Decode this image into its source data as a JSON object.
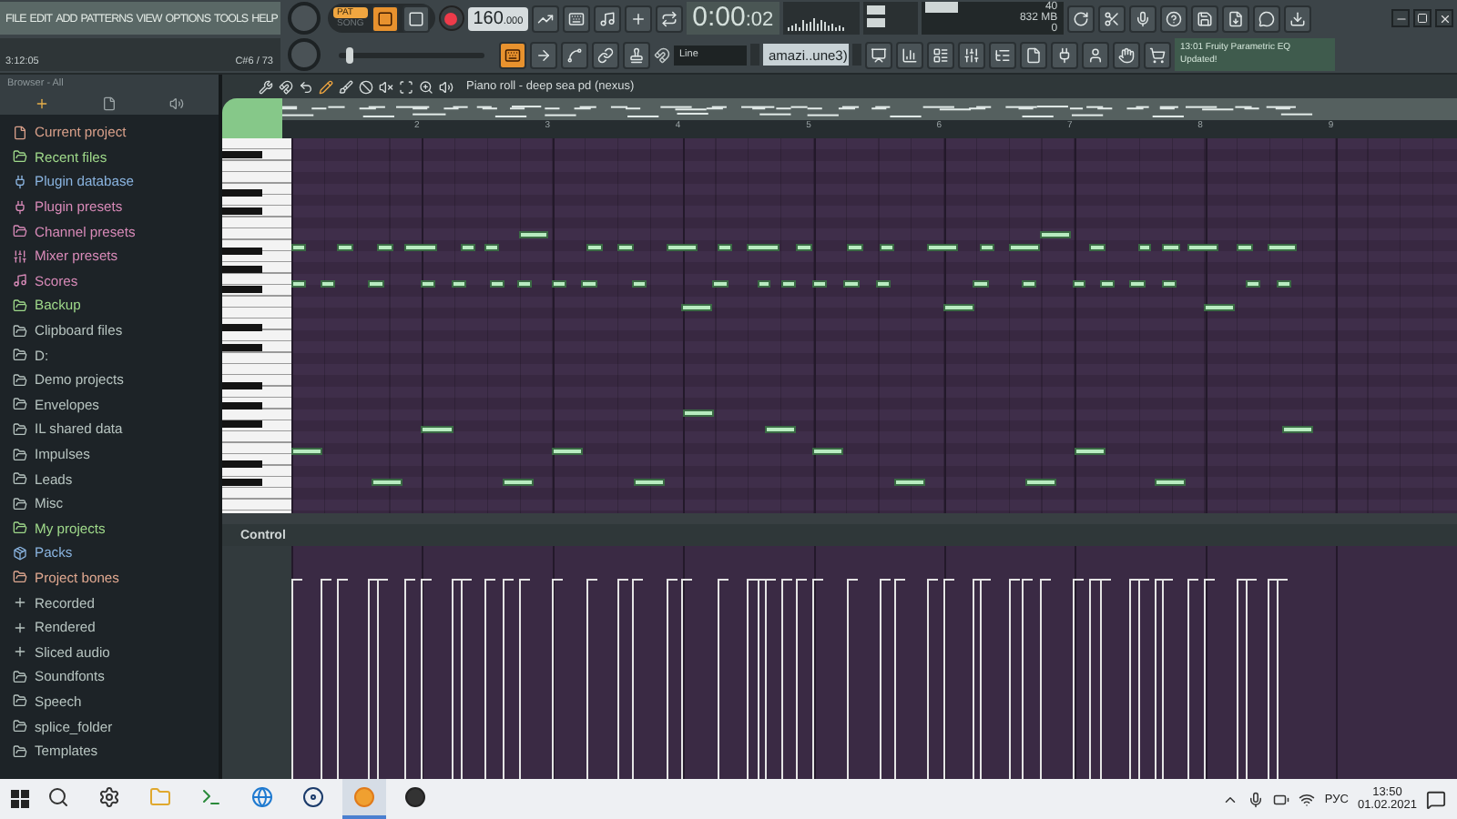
{
  "menu": [
    "FILE",
    "EDIT",
    "ADD",
    "PATTERNS",
    "VIEW",
    "OPTIONS",
    "TOOLS",
    "HELP"
  ],
  "hint_bar": {
    "time": "3:12:05",
    "note": "C#6 / 73"
  },
  "pitch": {
    "level": 0.05
  },
  "transport": {
    "modes": [
      {
        "label": "PAT",
        "selected": true
      },
      {
        "label": "SONG",
        "selected": false
      }
    ],
    "tempo": "160",
    "tempo_fraction": ".000",
    "time": "0:00",
    "seconds": ":02"
  },
  "monitor": {
    "voices": "40",
    "memory": "832 MB",
    "cpu": "0"
  },
  "snap": "Line",
  "pattern": "amazi..une3)",
  "news": {
    "text": "13:01  Fruity Parametric EQ",
    "subtext": "Updated!"
  },
  "browser": {
    "title": "Browser - All",
    "items": [
      {
        "label": "Current project",
        "color": "#d9a08a",
        "kind": "project"
      },
      {
        "label": "Recent files",
        "color": "#9fd98a",
        "kind": "folder"
      },
      {
        "label": "Plugin database",
        "color": "#8ab4e0",
        "kind": "plug"
      },
      {
        "label": "Plugin presets",
        "color": "#d88ab8",
        "kind": "plug"
      },
      {
        "label": "Channel presets",
        "color": "#d88ab8",
        "kind": "folder"
      },
      {
        "label": "Mixer presets",
        "color": "#d88ab8",
        "kind": "sliders"
      },
      {
        "label": "Scores",
        "color": "#d88ab8",
        "kind": "note"
      },
      {
        "label": "Backup",
        "color": "#9fd98a",
        "kind": "folder"
      },
      {
        "label": "Clipboard files",
        "color": "#b7c4c0",
        "kind": "folder"
      },
      {
        "label": "D:",
        "color": "#b7c4c0",
        "kind": "folder"
      },
      {
        "label": "Demo projects",
        "color": "#b7c4c0",
        "kind": "folder"
      },
      {
        "label": "Envelopes",
        "color": "#b7c4c0",
        "kind": "folder"
      },
      {
        "label": "IL shared data",
        "color": "#b7c4c0",
        "kind": "folder"
      },
      {
        "label": "Impulses",
        "color": "#b7c4c0",
        "kind": "folder"
      },
      {
        "label": "Leads",
        "color": "#b7c4c0",
        "kind": "folder"
      },
      {
        "label": "Misc",
        "color": "#b7c4c0",
        "kind": "folder"
      },
      {
        "label": "My projects",
        "color": "#9fd98a",
        "kind": "folder"
      },
      {
        "label": "Packs",
        "color": "#8ab4e0",
        "kind": "pack"
      },
      {
        "label": "Project bones",
        "color": "#e0a890",
        "kind": "folder"
      },
      {
        "label": "Recorded",
        "color": "#b7c4c0",
        "kind": "plus"
      },
      {
        "label": "Rendered",
        "color": "#b7c4c0",
        "kind": "plus"
      },
      {
        "label": "Sliced audio",
        "color": "#b7c4c0",
        "kind": "plus"
      },
      {
        "label": "Soundfonts",
        "color": "#b7c4c0",
        "kind": "folder"
      },
      {
        "label": "Speech",
        "color": "#b7c4c0",
        "kind": "folder"
      },
      {
        "label": "splice_folder",
        "color": "#b7c4c0",
        "kind": "folder"
      },
      {
        "label": "Templates",
        "color": "#b7c4c0",
        "kind": "folder"
      }
    ]
  },
  "piano_roll": {
    "title": "Piano roll - deep sea pd (nexus)",
    "bars": [
      "2",
      "3",
      "4",
      "5",
      "6",
      "7",
      "8",
      "9"
    ],
    "control": "Control"
  },
  "taskbar": {
    "apps": [
      {
        "kind": "settings",
        "selected": false
      },
      {
        "kind": "files",
        "selected": false
      },
      {
        "kind": "terminal",
        "selected": false
      },
      {
        "kind": "browser",
        "selected": false
      },
      {
        "kind": "steam",
        "selected": false
      },
      {
        "kind": "daw",
        "selected": true
      },
      {
        "kind": "recorder",
        "selected": false
      }
    ],
    "language": "РУС",
    "clock": "13:50",
    "date": "01.02.2021"
  }
}
